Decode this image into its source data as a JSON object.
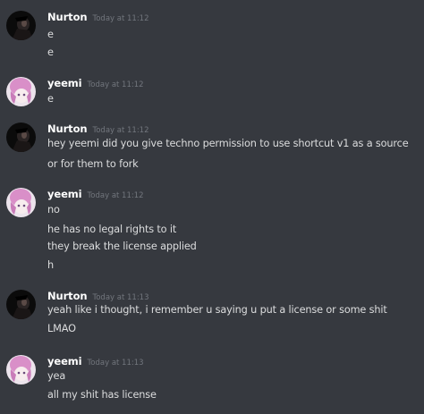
{
  "messages": [
    {
      "username": "Nurton",
      "timestamp": "Today at 11:12",
      "avatar": "nurton-avatar",
      "lines": [
        "e",
        "e"
      ]
    },
    {
      "username": "yeemi",
      "timestamp": "Today at 11:12",
      "avatar": "yeemi-avatar",
      "lines": [
        "e"
      ]
    },
    {
      "username": "Nurton",
      "timestamp": "Today at 11:12",
      "avatar": "nurton-avatar",
      "lines": [
        "hey yeemi did you give techno permission to use shortcut v1 as a source",
        "or for them to fork"
      ]
    },
    {
      "username": "yeemi",
      "timestamp": "Today at 11:12",
      "avatar": "yeemi-avatar",
      "lines": [
        "no",
        "he has no legal rights to it",
        "they break the license applied",
        "h"
      ]
    },
    {
      "username": "Nurton",
      "timestamp": "Today at 11:13",
      "avatar": "nurton-avatar",
      "lines": [
        "yeah like i thought, i remember u saying u put a license or some shit",
        "LMAO"
      ]
    },
    {
      "username": "yeemi",
      "timestamp": "Today at 11:13",
      "avatar": "yeemi-avatar",
      "lines": [
        "yea",
        "all my shit has license"
      ]
    }
  ],
  "colors": {
    "background": "#36393f",
    "username": "#ffffff",
    "timestamp": "#72767d",
    "message_text": "#dcddde"
  }
}
